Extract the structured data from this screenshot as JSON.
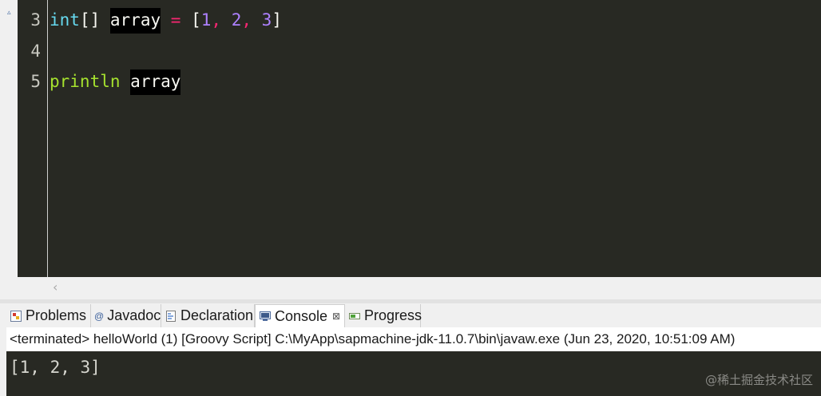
{
  "editor": {
    "lines": [
      {
        "number": "3"
      },
      {
        "number": "4"
      },
      {
        "number": "5"
      }
    ],
    "line3": {
      "type": "int",
      "brackets": "[]",
      "var": "array",
      "eq": "=",
      "open": "[",
      "n1": "1",
      "c1": ",",
      "n2": "2",
      "c2": ",",
      "n3": "3",
      "close": "]"
    },
    "line5": {
      "fn": "println",
      "arg": "array"
    },
    "colors": {
      "background": "#282923",
      "keyword_type": "#66d9ef",
      "function": "#a6e22e",
      "operator": "#f92672",
      "number": "#ae81ff",
      "highlight": "#000000"
    }
  },
  "tabs": [
    {
      "label": "Problems",
      "icon": "problems-icon"
    },
    {
      "label": "Javadoc",
      "icon": "at-icon"
    },
    {
      "label": "Declaration",
      "icon": "declaration-icon"
    },
    {
      "label": "Console",
      "icon": "console-icon",
      "active": true,
      "close": "⊠"
    },
    {
      "label": "Progress",
      "icon": "progress-icon"
    }
  ],
  "console": {
    "status": "<terminated> helloWorld (1) [Groovy Script] C:\\MyApp\\sapmachine-jdk-11.0.7\\bin\\javaw.exe (Jun 23, 2020, 10:51:09 AM)",
    "output": "[1, 2, 3]"
  },
  "watermark": "@稀土掘金技术社区"
}
